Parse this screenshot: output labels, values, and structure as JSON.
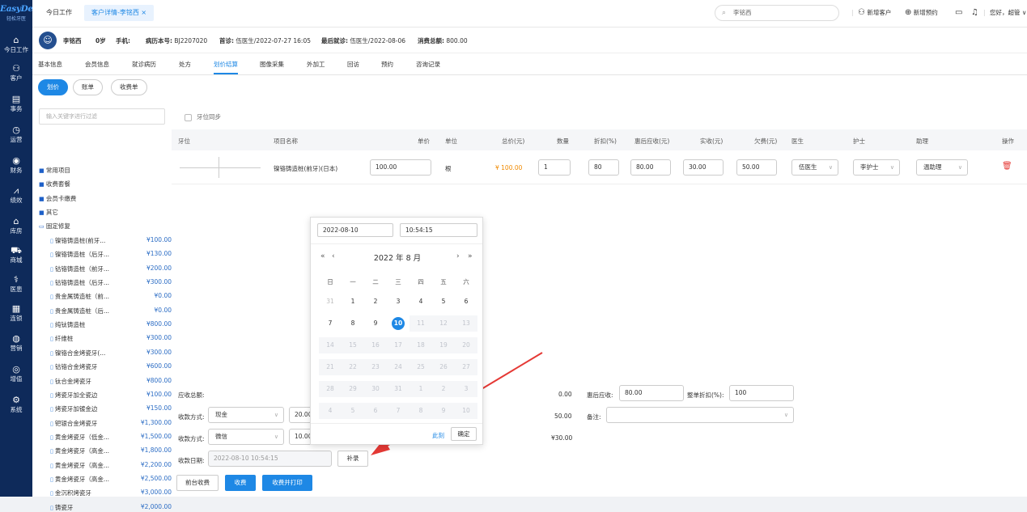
{
  "brand": {
    "name": "EasyDent",
    "subtitle": "轻松牙医"
  },
  "sidebar": [
    {
      "icon": "home-icon",
      "glyph": "⌂",
      "label": "今日工作"
    },
    {
      "icon": "user-icon",
      "glyph": "⚇",
      "label": "客户"
    },
    {
      "icon": "task-icon",
      "glyph": "▤",
      "label": "事务"
    },
    {
      "icon": "clock-icon",
      "glyph": "◷",
      "label": "运营"
    },
    {
      "icon": "finance-icon",
      "glyph": "◉",
      "label": "财务"
    },
    {
      "icon": "chart-icon",
      "glyph": "⩘",
      "label": "绩效"
    },
    {
      "icon": "warehouse-icon",
      "glyph": "⌂",
      "label": "库房"
    },
    {
      "icon": "cart-icon",
      "glyph": "⛟",
      "label": "商城"
    },
    {
      "icon": "doctor-icon",
      "glyph": "⚕",
      "label": "医患"
    },
    {
      "icon": "chain-icon",
      "glyph": "▦",
      "label": "连锁"
    },
    {
      "icon": "marketing-icon",
      "glyph": "◍",
      "label": "营销"
    },
    {
      "icon": "addon-icon",
      "glyph": "◎",
      "label": "增值"
    },
    {
      "icon": "gear-icon",
      "glyph": "⚙",
      "label": "系统"
    }
  ],
  "topbar": {
    "tabs": [
      {
        "label": "今日工作"
      },
      {
        "label": "客户详情-李铭西 ×"
      }
    ],
    "search_value": "李铭西",
    "new_customer": "新增客户",
    "new_appointment": "新增预约",
    "greeting": "您好，超管 ∨"
  },
  "patient": {
    "name": "李铭西",
    "age": "0岁",
    "phone_label": "手机:",
    "record_label": "病历本号:",
    "record_no": "BJ2207020",
    "first_label": "首诊:",
    "first_visit": "伍医生/2022-07-27 16:05",
    "last_label": "最后就诊:",
    "last_visit": "伍医生/2022-08-06",
    "total_label": "消费总额:",
    "total": "800.00"
  },
  "subtabs": [
    "基本信息",
    "会员信息",
    "就诊病历",
    "处方",
    "划价结算",
    "图像采集",
    "外加工",
    "回访",
    "预约",
    "咨询记录"
  ],
  "pills": [
    "划价",
    "账单",
    "收费单"
  ],
  "filter_placeholder": "输入关键字进行过滤",
  "tree": {
    "folders": [
      "常用项目",
      "收费套餐",
      "会员卡缴费",
      "其它",
      "固定修复"
    ],
    "items": [
      {
        "name": "镍铬铸造桩(前牙...",
        "price": "¥100.00"
      },
      {
        "name": "镍铬铸造桩（后牙...",
        "price": "¥130.00"
      },
      {
        "name": "钴铬铸造桩（前牙...",
        "price": "¥200.00"
      },
      {
        "name": "钴铬铸造桩（后牙...",
        "price": "¥300.00"
      },
      {
        "name": "贵金属铸造桩（前...",
        "price": "¥0.00"
      },
      {
        "name": "贵金属铸造桩（后...",
        "price": "¥0.00"
      },
      {
        "name": "纯钛铸造桩",
        "price": "¥800.00"
      },
      {
        "name": "纤维桩",
        "price": "¥300.00"
      },
      {
        "name": "镍铬合金烤瓷牙(...",
        "price": "¥300.00"
      },
      {
        "name": "钴铬合金烤瓷牙",
        "price": "¥600.00"
      },
      {
        "name": "钛合金烤瓷牙",
        "price": "¥800.00"
      },
      {
        "name": "烤瓷牙加全瓷边",
        "price": "¥100.00"
      },
      {
        "name": "烤瓷牙加镀金边",
        "price": "¥150.00"
      },
      {
        "name": "钯银合金烤瓷牙",
        "price": "¥1,300.00"
      },
      {
        "name": "黄金烤瓷牙（低金...",
        "price": "¥1,500.00"
      },
      {
        "name": "黄金烤瓷牙（高金...",
        "price": "¥1,800.00"
      },
      {
        "name": "黄金烤瓷牙（高金...",
        "price": "¥2,200.00"
      },
      {
        "name": "黄金烤瓷牙（高金...",
        "price": "¥2,500.00"
      },
      {
        "name": "金沉积烤瓷牙",
        "price": "¥3,000.00"
      },
      {
        "name": "铸瓷牙",
        "price": "¥2,000.00"
      }
    ]
  },
  "table": {
    "sync_label": "牙位同步",
    "headers": [
      "牙位",
      "项目名称",
      "单价",
      "单位",
      "总价(元)",
      "数量",
      "折扣(%)",
      "惠后应收(元)",
      "实收(元)",
      "欠费(元)",
      "医生",
      "护士",
      "助理",
      "操作"
    ],
    "row": {
      "item": "镍铬铸造桩(前牙)(日本)",
      "unit_price": "100.00",
      "unit": "根",
      "total": "¥ 100.00",
      "qty": "1",
      "discount": "80",
      "after_discount": "80.00",
      "paid": "30.00",
      "owed": "50.00",
      "doctor": "伍医生",
      "nurse": "李护士",
      "assistant": "温助理"
    }
  },
  "settle": {
    "due_label": "应收总额:",
    "due_value": "0.00",
    "after_label": "惠后应收:",
    "after_value": "80.00",
    "whole_label": "整单折扣(%):",
    "whole_value": "100",
    "pay1_label": "收款方式:",
    "pay1_method": "现金",
    "pay1_amount": "20.00",
    "pay1_right": "50.00",
    "note_label": "备注:",
    "pay2_label": "收款方式:",
    "pay2_method": "微信",
    "pay2_amount": "10.00",
    "pay2_right": "¥30.00",
    "date_label": "收款日期:",
    "date_value": "2022-08-10 10:54:15",
    "backfill": "补录",
    "btn_front": "前台收费",
    "btn_charge": "收费",
    "btn_charge_print": "收费并打印"
  },
  "picker": {
    "date": "2022-08-10",
    "time": "10:54:15",
    "year": "2022 年",
    "month": "8 月",
    "weekdays": [
      "日",
      "一",
      "二",
      "三",
      "四",
      "五",
      "六"
    ],
    "days": [
      "31",
      "1",
      "2",
      "3",
      "4",
      "5",
      "6",
      "7",
      "8",
      "9",
      "10",
      "11",
      "12",
      "13",
      "14",
      "15",
      "16",
      "17",
      "18",
      "19",
      "20",
      "21",
      "22",
      "23",
      "24",
      "25",
      "26",
      "27",
      "28",
      "29",
      "30",
      "31",
      "1",
      "2",
      "3",
      "4",
      "5",
      "6",
      "7",
      "8",
      "9",
      "10"
    ],
    "selected": "10",
    "now": "此刻",
    "confirm": "确定"
  },
  "colors": {
    "primary": "#1e88e5",
    "sidebar": "#0e2a5a",
    "danger": "#e53935",
    "price": "#f08a00"
  }
}
